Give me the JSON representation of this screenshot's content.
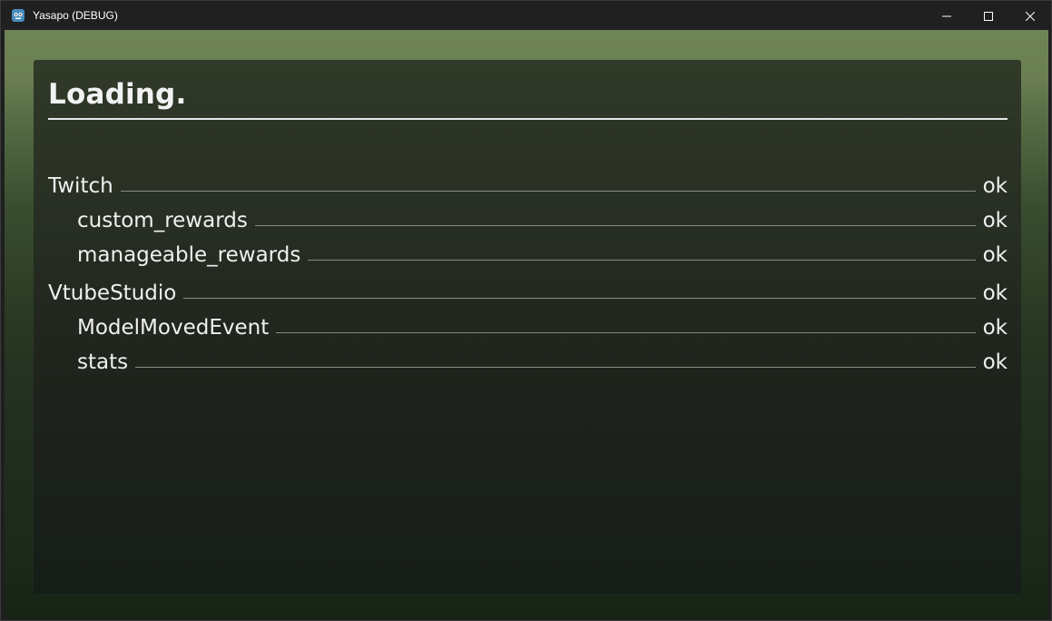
{
  "window": {
    "title": "Yasapo (DEBUG)",
    "controls": {
      "minimize": "minimize-icon",
      "maximize": "maximize-icon",
      "close": "close-icon"
    }
  },
  "loading": {
    "heading": "Loading.",
    "items": [
      {
        "label": "Twitch",
        "status": "ok",
        "level": 0
      },
      {
        "label": "custom_rewards",
        "status": "ok",
        "level": 1
      },
      {
        "label": "manageable_rewards",
        "status": "ok",
        "level": 1
      },
      {
        "label": "VtubeStudio",
        "status": "ok",
        "level": 0
      },
      {
        "label": "ModelMovedEvent",
        "status": "ok",
        "level": 1
      },
      {
        "label": "stats",
        "status": "ok",
        "level": 1
      }
    ]
  },
  "colors": {
    "titlebar": "#202020",
    "text": "#f0f0f0",
    "accent_green": "#6f8456"
  }
}
